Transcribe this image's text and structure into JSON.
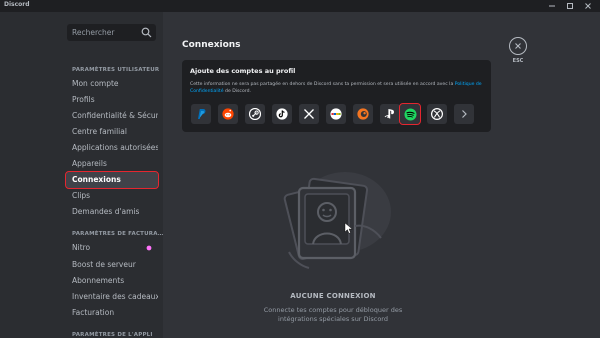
{
  "window": {
    "title": "Discord"
  },
  "sidebar": {
    "search_placeholder": "Rechercher",
    "sections": [
      {
        "heading": "PARAMÈTRES UTILISATEUR",
        "items": [
          "Mon compte",
          "Profils",
          "Confidentialité & Sécur…",
          "Centre familial",
          "Applications autorisées",
          "Appareils",
          "Connexions",
          "Clips",
          "Demandes d'amis"
        ]
      },
      {
        "heading": "PARAMÈTRES DE FACTURA…",
        "items": [
          "Nitro",
          "Boost de serveur",
          "Abonnements",
          "Inventaire des cadeaux",
          "Facturation"
        ]
      },
      {
        "heading": "PARAMÈTRES DE L'APPLI"
      }
    ],
    "active_item": "Connexions"
  },
  "main": {
    "title": "Connexions",
    "card": {
      "title": "Ajoute des comptes au profil",
      "desc_before": "Cette information ne sera pas partagée en dehors de Discord sans ta permission et sera utilisée en accord avec la ",
      "desc_link": "Politique de Confidentialité",
      "desc_after": " de Discord."
    },
    "services": [
      "paypal-icon",
      "reddit-icon",
      "steam-icon",
      "tiktok-icon",
      "x-icon",
      "ebay-icon",
      "crunchyroll-icon",
      "playstation-icon",
      "spotify-icon",
      "xbox-icon",
      "chevron-right-icon"
    ],
    "highlighted_service": "spotify-icon",
    "close_label": "ESC",
    "empty": {
      "title": "AUCUNE CONNEXION",
      "subtitle": "Connecte tes comptes pour débloquer des intégrations spéciales sur Discord"
    }
  },
  "colors": {
    "accent_link": "#00a8fc",
    "highlight": "#e5262f",
    "spotify": "#1ed760",
    "nitro": "#ff73fa"
  }
}
